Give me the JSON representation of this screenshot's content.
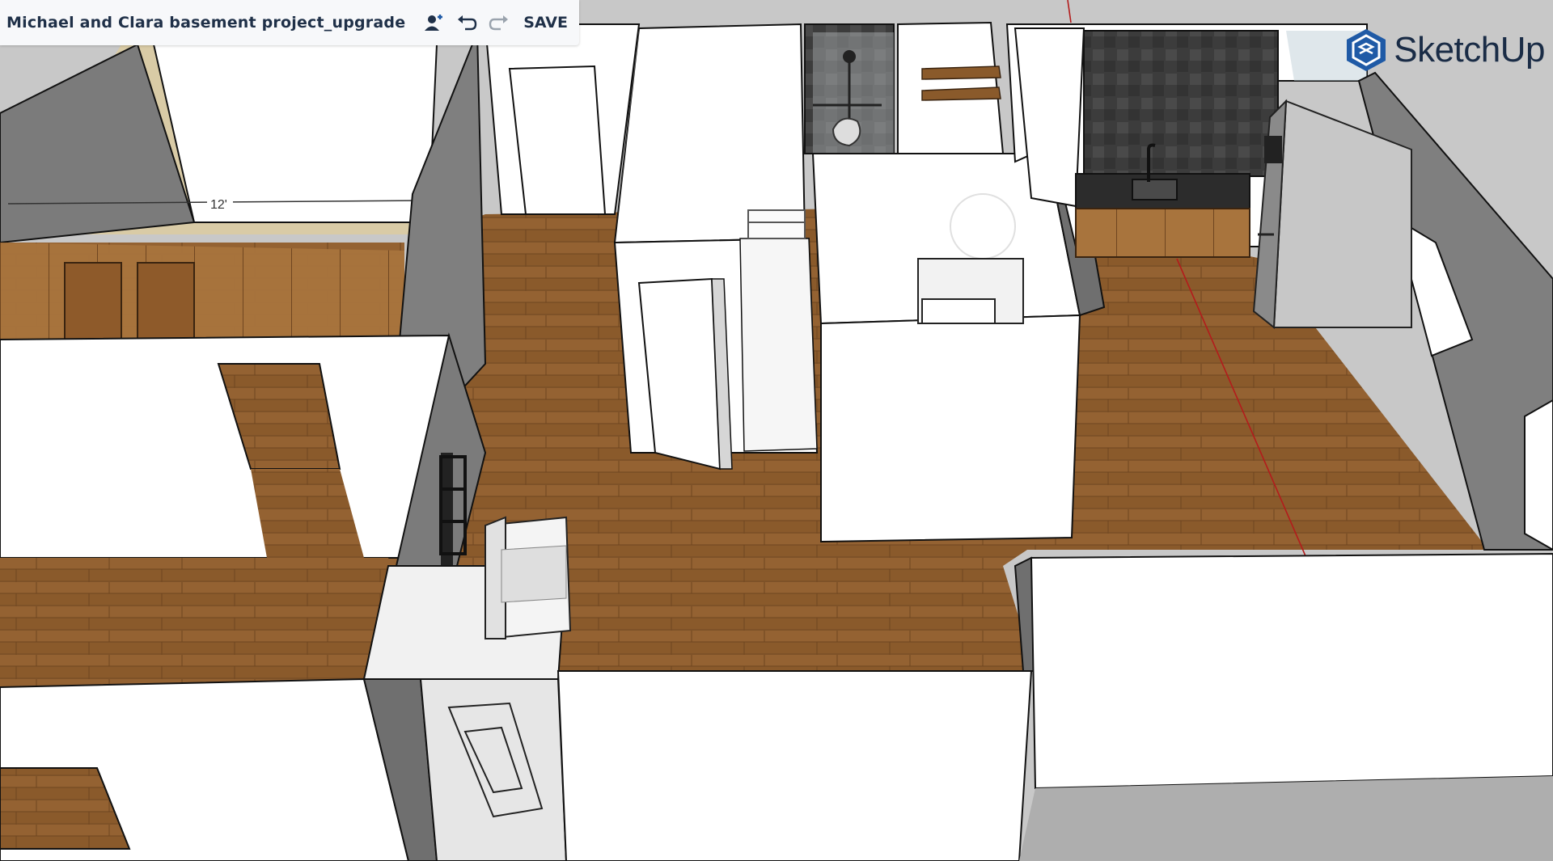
{
  "toolbar": {
    "project_title": "Michael and Clara basement project_upgrade",
    "save_label": "SAVE",
    "icons": [
      "add-collaborator-icon",
      "undo-icon",
      "redo-icon"
    ]
  },
  "brand": {
    "logo_text": "SketchUp",
    "accent_color": "#1f5aa6"
  },
  "model": {
    "dimension_label": "12'"
  },
  "colors": {
    "floor": "#8a5a2b",
    "wall": "#ffffff",
    "wall_side": "#7a7a7a",
    "backsplash": "#3a3a3a",
    "cabinet": "#a8743d"
  }
}
